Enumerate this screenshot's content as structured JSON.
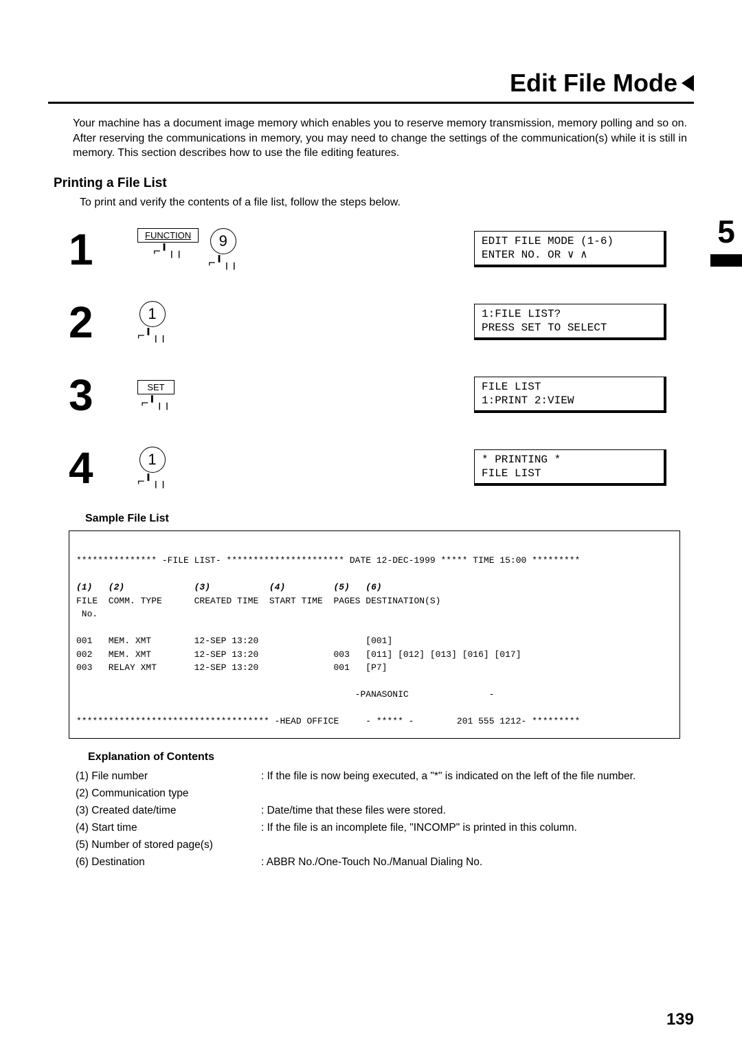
{
  "title": "Edit File Mode",
  "intro": "Your machine has a document image memory which enables you to reserve memory transmission, memory polling and so on.  After reserving the communications in memory, you may need to change the settings of the communication(s) while it is still in memory.  This section describes how to use the file editing features.",
  "chapter_number": "5",
  "page_number": "139",
  "section": {
    "heading": "Printing a File List",
    "intro": "To print and verify the contents of a file list, follow the steps below."
  },
  "steps": [
    {
      "num": "1",
      "keys": [
        {
          "type": "rect",
          "label": "FUNCTION",
          "underline": true
        },
        {
          "type": "circle",
          "label": "9"
        }
      ],
      "lcd": "EDIT FILE MODE (1-6)\nENTER NO. OR ∨ ∧"
    },
    {
      "num": "2",
      "keys": [
        {
          "type": "circle",
          "label": "1"
        }
      ],
      "lcd": "1:FILE LIST?\nPRESS SET TO SELECT"
    },
    {
      "num": "3",
      "keys": [
        {
          "type": "rect",
          "label": "SET",
          "underline": false
        }
      ],
      "lcd": "FILE LIST\n1:PRINT 2:VIEW"
    },
    {
      "num": "4",
      "keys": [
        {
          "type": "circle",
          "label": "1"
        }
      ],
      "lcd": "* PRINTING *\nFILE LIST"
    }
  ],
  "sample_heading": "Sample File List",
  "listing": {
    "top": "*************** -FILE LIST- ********************** DATE 12-DEC-1999 ***** TIME 15:00 *********",
    "cols_italic": "(1)   (2)             (3)           (4)         (5)   (6)",
    "cols_head": "FILE  COMM. TYPE      CREATED TIME  START TIME  PAGES DESTINATION(S)",
    "cols_sub": " No.",
    "rows": [
      "001   MEM. XMT        12-SEP 13:20                    [001]",
      "002   MEM. XMT        12-SEP 13:20              003   [011] [012] [013] [016] [017]",
      "003   RELAY XMT       12-SEP 13:20              001   [P7]"
    ],
    "footer1": "                                                    -PANASONIC               -",
    "footer2": "************************************ -HEAD OFFICE     - ***** -        201 555 1212- *********"
  },
  "explanation_heading": "Explanation of Contents",
  "explanations": [
    {
      "l": "(1) File number",
      "r": ": If the file is now being executed, a \"*\" is indicated on the left of the file number."
    },
    {
      "l": "(2) Communication type",
      "r": ""
    },
    {
      "l": "(3) Created date/time",
      "r": ": Date/time that these files were stored."
    },
    {
      "l": "(4) Start time",
      "r": ": If the file is an incomplete file, \"INCOMP\" is printed in this column."
    },
    {
      "l": "(5) Number of stored page(s)",
      "r": ""
    },
    {
      "l": "(6) Destination",
      "r": ": ABBR No./One-Touch No./Manual Dialing No."
    }
  ]
}
